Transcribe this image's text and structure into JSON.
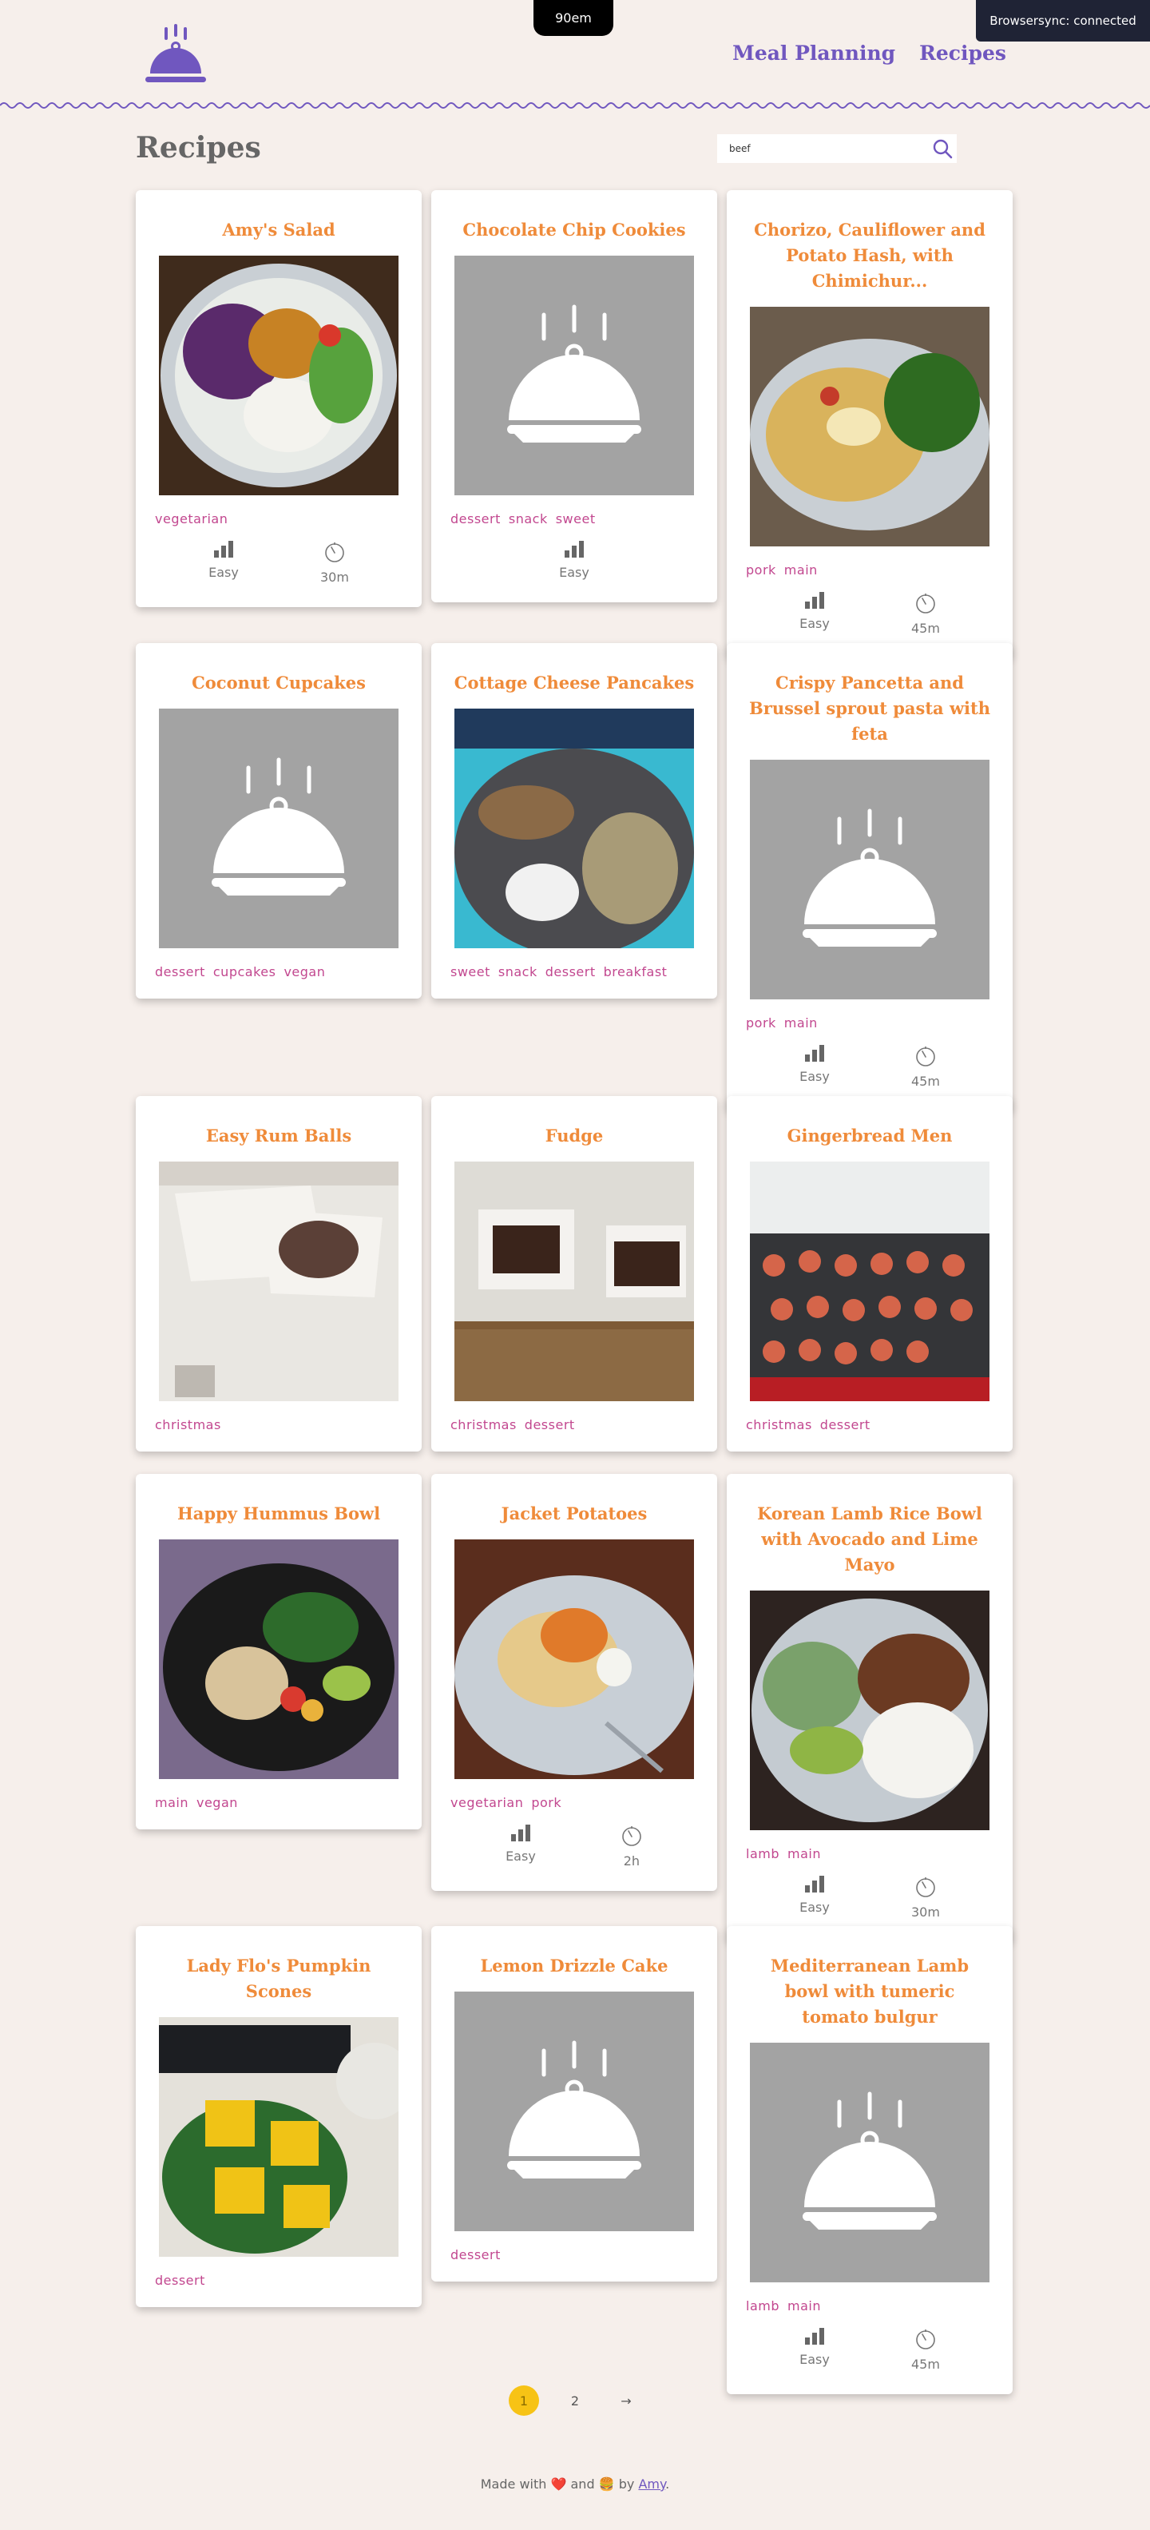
{
  "header": {
    "timer_label": "90em",
    "nav": [
      "Meal Planning",
      "Recipes"
    ],
    "browsersync": "Browsersync: connected"
  },
  "page": {
    "title": "Recipes",
    "search_value": "beef"
  },
  "colors": {
    "accent": "#7057bf",
    "title": "#ef8b3a",
    "tag": "#c2478f",
    "page_active": "#f7c315",
    "placeholder_bg": "#a3a3a3"
  },
  "recipes": [
    {
      "title": "Amy's Salad",
      "tags": [
        "vegetarian"
      ],
      "difficulty": "Easy",
      "time": "30m",
      "image": "photo"
    },
    {
      "title": "Chocolate Chip Cookies",
      "tags": [
        "dessert",
        "snack",
        "sweet"
      ],
      "difficulty": "Easy",
      "time": "",
      "image": "placeholder"
    },
    {
      "title": "Chorizo, Cauliflower and Potato Hash, with Chimichur...",
      "tags": [
        "pork",
        "main"
      ],
      "difficulty": "Easy",
      "time": "45m",
      "image": "photo"
    },
    {
      "title": "Coconut Cupcakes",
      "tags": [
        "dessert",
        "cupcakes",
        "vegan"
      ],
      "difficulty": "",
      "time": "",
      "image": "placeholder"
    },
    {
      "title": "Cottage Cheese Pancakes",
      "tags": [
        "sweet",
        "snack",
        "dessert",
        "breakfast"
      ],
      "difficulty": "",
      "time": "",
      "image": "photo"
    },
    {
      "title": "Crispy Pancetta and Brussel sprout pasta with feta",
      "tags": [
        "pork",
        "main"
      ],
      "difficulty": "Easy",
      "time": "45m",
      "image": "placeholder"
    },
    {
      "title": "Easy Rum Balls",
      "tags": [
        "christmas"
      ],
      "difficulty": "",
      "time": "",
      "image": "photo"
    },
    {
      "title": "Fudge",
      "tags": [
        "christmas",
        "dessert"
      ],
      "difficulty": "",
      "time": "",
      "image": "photo"
    },
    {
      "title": "Gingerbread Men",
      "tags": [
        "christmas",
        "dessert"
      ],
      "difficulty": "",
      "time": "",
      "image": "photo"
    },
    {
      "title": "Happy Hummus Bowl",
      "tags": [
        "main",
        "vegan"
      ],
      "difficulty": "",
      "time": "",
      "image": "photo"
    },
    {
      "title": "Jacket Potatoes",
      "tags": [
        "vegetarian",
        "pork"
      ],
      "difficulty": "Easy",
      "time": "2h",
      "image": "photo"
    },
    {
      "title": "Korean Lamb Rice Bowl with Avocado and Lime Mayo",
      "tags": [
        "lamb",
        "main"
      ],
      "difficulty": "Easy",
      "time": "30m",
      "image": "photo"
    },
    {
      "title": "Lady Flo's Pumpkin Scones",
      "tags": [
        "dessert"
      ],
      "difficulty": "",
      "time": "",
      "image": "photo"
    },
    {
      "title": "Lemon Drizzle Cake",
      "tags": [
        "dessert"
      ],
      "difficulty": "",
      "time": "",
      "image": "placeholder"
    },
    {
      "title": "Mediterranean Lamb bowl with tumeric tomato bulgur",
      "tags": [
        "lamb",
        "main"
      ],
      "difficulty": "Easy",
      "time": "45m",
      "image": "placeholder"
    }
  ],
  "pagination": {
    "pages": [
      "1",
      "2"
    ],
    "current": "1",
    "next": "→"
  },
  "footer": {
    "prefix": "Made with",
    "heart": "❤️",
    "and": "and",
    "burger": "🍔",
    "by": "by",
    "author": "Amy",
    "suffix": "."
  }
}
